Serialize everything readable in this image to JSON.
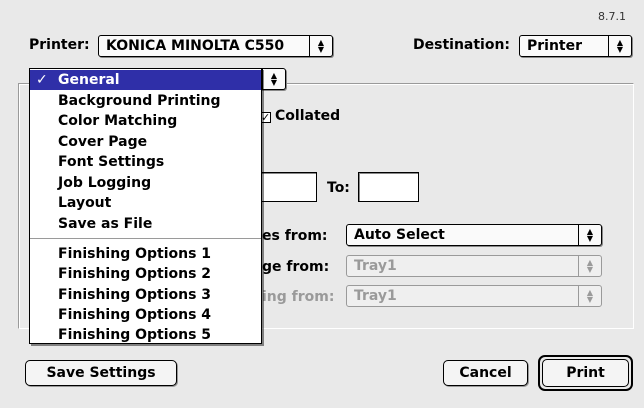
{
  "version": "8.7.1",
  "printer": {
    "label": "Printer:",
    "value": "KONICA MINOLTA C550"
  },
  "destination": {
    "label": "Destination:",
    "value": "Printer"
  },
  "panel_menu": {
    "items_top": [
      "General",
      "Background Printing",
      "Color Matching",
      "Cover Page",
      "Font Settings",
      "Job Logging",
      "Layout",
      "Save as File"
    ],
    "items_bottom": [
      "Finishing Options 1",
      "Finishing Options 2",
      "Finishing Options 3",
      "Finishing Options 4",
      "Finishing Options 5"
    ],
    "selected": "General",
    "check_glyph": "✓"
  },
  "copies": {
    "collated_label": "Collated",
    "collated_checked": true
  },
  "pages": {
    "to_label": "To:",
    "from_value": "",
    "to_value": ""
  },
  "paper_source": {
    "row1_label_visible": "es from:",
    "row1_value": "Auto Select",
    "row2_label_visible": "ge from:",
    "row2_value": "Tray1",
    "row3_label_visible": "ing from:",
    "row3_value": "Tray1"
  },
  "buttons": {
    "save_settings": "Save Settings",
    "cancel": "Cancel",
    "print": "Print"
  },
  "colors": {
    "menu_highlight": "#2f2fa8",
    "dialog_bg": "#e9e9e9"
  }
}
